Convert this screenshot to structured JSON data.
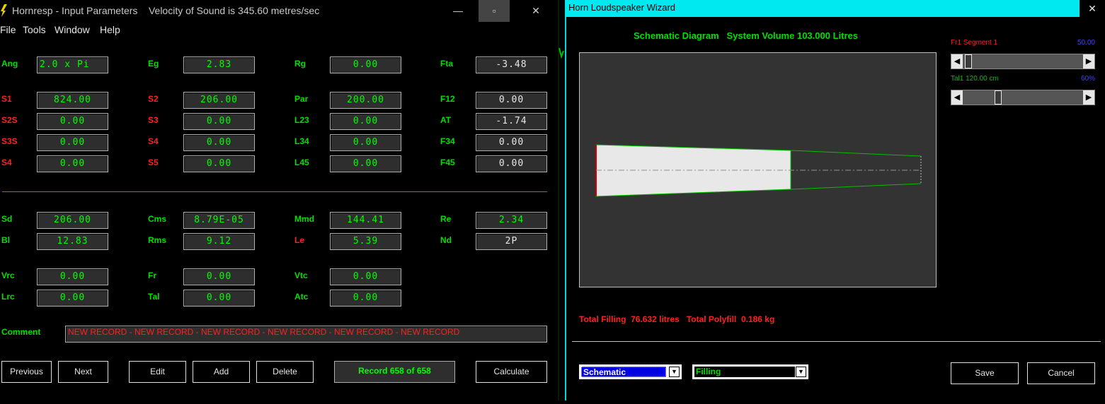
{
  "left_window": {
    "title": "Hornresp - Input Parameters",
    "title_info": "Velocity of Sound is 345.60 metres/sec",
    "controls": {
      "minimize": "—",
      "maximize": "▫",
      "close": "✕"
    },
    "menu": [
      "File",
      "Tools",
      "Window",
      "Help"
    ],
    "params": {
      "Ang": "2.0 x Pi",
      "Eg": "2.83",
      "Rg": "0.00",
      "Fta": "-3.48",
      "S1": "824.00",
      "S2": "206.00",
      "Par": "200.00",
      "F12": "0.00",
      "S2S": "0.00",
      "S3": "0.00",
      "L23": "0.00",
      "AT": "-1.74",
      "S3S": "0.00",
      "S4a": "0.00",
      "L34": "0.00",
      "F34": "0.00",
      "S4b": "0.00",
      "S5": "0.00",
      "L45": "0.00",
      "F45": "0.00",
      "Sd": "206.00",
      "Cms": "8.79E-05",
      "Mmd": "144.41",
      "Re": "2.34",
      "Bl": "12.83",
      "Rms": "9.12",
      "Le": "5.39",
      "Nd": "2P",
      "Vrc": "0.00",
      "Fr": "0.00",
      "Vtc": "0.00",
      "Lrc": "0.00",
      "Tal": "0.00",
      "Atc": "0.00"
    },
    "labels": {
      "Ang": "Ang",
      "Eg": "Eg",
      "Rg": "Rg",
      "Fta": "Fta",
      "S1": "S1",
      "S2": "S2",
      "Par": "Par",
      "F12": "F12",
      "S2S": "S2S",
      "S3": "S3",
      "L23": "L23",
      "AT": "AT",
      "S3S": "S3S",
      "S4a": "S4",
      "L34": "L34",
      "F34": "F34",
      "S4b": "S4",
      "S5": "S5",
      "L45": "L45",
      "F45": "F45",
      "Sd": "Sd",
      "Cms": "Cms",
      "Mmd": "Mmd",
      "Re": "Re",
      "Bl": "Bl",
      "Rms": "Rms",
      "Le": "Le",
      "Nd": "Nd",
      "Vrc": "Vrc",
      "Fr": "Fr",
      "Vtc": "Vtc",
      "Lrc": "Lrc",
      "Tal": "Tal",
      "Atc": "Atc",
      "Comment": "Comment"
    },
    "comment": "NEW RECORD - NEW RECORD - NEW RECORD - NEW RECORD - NEW RECORD - NEW RECORD",
    "buttons": {
      "previous": "Previous",
      "next": "Next",
      "edit": "Edit",
      "add": "Add",
      "delete": "Delete",
      "calculate": "Calculate"
    },
    "record": "Record 658 of 658"
  },
  "right_window": {
    "title": "Horn Loudspeaker Wizard",
    "close": "✕",
    "heading": "Schematic Diagram   System Volume 103.000 Litres",
    "slider1": {
      "label": "Fr1  Segment 1",
      "value_text": "50.00",
      "position": 0.02
    },
    "slider2": {
      "label": "Tal1  120.00 cm",
      "value_text": "60%",
      "position": 0.28
    },
    "filling_info": "Total Filling  76.632 litres   Total Polyfill  0.186 kg",
    "dropdown1": "Schematic",
    "dropdown2": "Filling",
    "save": "Save",
    "cancel": "Cancel",
    "colors": {
      "accent": "#00e8f0",
      "green": "#00e000",
      "red": "#ff2020",
      "blue_value": "#4040ff"
    }
  }
}
